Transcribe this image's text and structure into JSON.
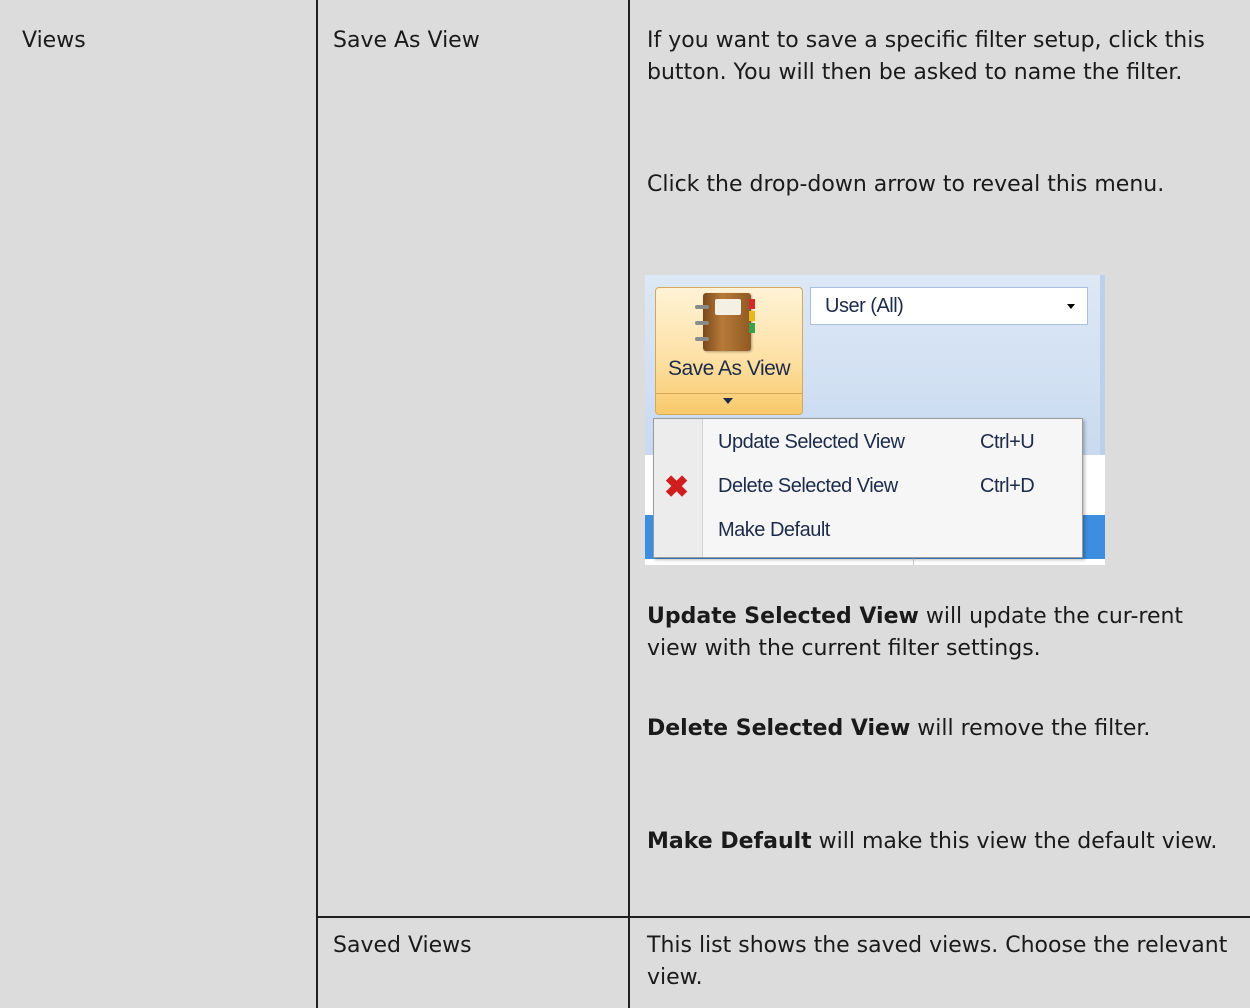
{
  "table": {
    "row1": {
      "col1": "Views",
      "col2": "Save As View",
      "desc1": "If you want to save a specific filter setup, click this button. You will then be asked to name the filter.",
      "desc2": "Click the drop-down arrow to reveal this menu.",
      "update_bold": "Update Selected View",
      "update_rest": " will update the cur-rent view with the current filter settings.",
      "delete_bold": "Delete Selected View",
      "delete_rest": " will remove the filter.",
      "default_bold": "Make Default",
      "default_rest": " will make this view the default view."
    },
    "row2": {
      "col2": "Saved Views",
      "desc": "This list shows the saved views. Choose the relevant view."
    }
  },
  "screenshot": {
    "save_as_view_label": "Save As View",
    "user_combo_value": "User (All)",
    "menu": [
      {
        "label": "Update Selected View",
        "shortcut": "Ctrl+U",
        "icon": ""
      },
      {
        "label": "Delete Selected View",
        "shortcut": "Ctrl+D",
        "icon": "red-x-icon"
      },
      {
        "label": "Make Default",
        "shortcut": "",
        "icon": ""
      }
    ],
    "colors": {
      "delete_icon": "#d01e1e",
      "selected_row": "#3d8ee0"
    }
  }
}
